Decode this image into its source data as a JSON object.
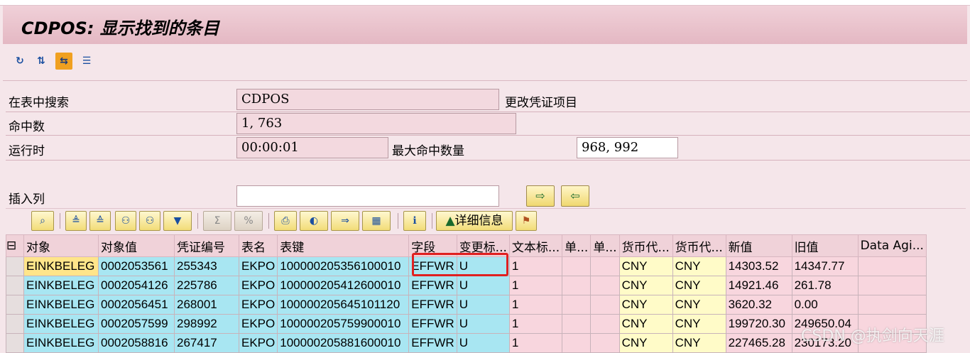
{
  "window": {
    "title": "CDPOS: 显示找到的条目"
  },
  "toolbar": {
    "icons": [
      "refresh-icon",
      "filter-icon",
      "export-icon",
      "list-icon"
    ]
  },
  "header": {
    "search_in_table_label": "在表中搜索",
    "table_name": "CDPOS",
    "table_description": "更改凭证项目",
    "hit_count_label": "命中数",
    "hit_count": "1, 763",
    "runtime_label": "运行时",
    "runtime": "00:00:01",
    "max_hits_label": "最大命中数量",
    "max_hits": "968, 992",
    "insert_column_label": "插入列",
    "insert_column_value": ""
  },
  "grid_toolbar": {
    "details_label": "详细信息"
  },
  "table": {
    "columns": [
      "对象",
      "对象值",
      "凭证编号",
      "表名",
      "表键",
      "字段",
      "变更标...",
      "文本标...",
      "单...",
      "单...",
      "货币代...",
      "货币代...",
      "新值",
      "旧值",
      "Data Agi..."
    ],
    "rows": [
      [
        "EINKBELEG",
        "0002053561",
        "255343",
        "EKPO",
        "100000205356100010",
        "EFFWR",
        "U",
        "1",
        "",
        "",
        "CNY",
        "CNY",
        "14303.52",
        "14347.77",
        ""
      ],
      [
        "EINKBELEG",
        "0002054126",
        "225786",
        "EKPO",
        "100000205412600010",
        "EFFWR",
        "U",
        "1",
        "",
        "",
        "CNY",
        "CNY",
        "14921.46",
        "261.78",
        ""
      ],
      [
        "EINKBELEG",
        "0002056451",
        "268001",
        "EKPO",
        "100000205645101120",
        "EFFWR",
        "U",
        "1",
        "",
        "",
        "CNY",
        "CNY",
        "3620.32",
        "0.00",
        ""
      ],
      [
        "EINKBELEG",
        "0002057599",
        "298992",
        "EKPO",
        "100000205759900010",
        "EFFWR",
        "U",
        "1",
        "",
        "",
        "CNY",
        "CNY",
        "199720.30",
        "249650.04",
        ""
      ],
      [
        "EINKBELEG",
        "0002058816",
        "267417",
        "EKPO",
        "100000205881600010",
        "EFFWR",
        "U",
        "1",
        "",
        "",
        "CNY",
        "CNY",
        "227465.28",
        "230173.20",
        ""
      ]
    ]
  },
  "watermark": "CSDN @执剑向天涯"
}
